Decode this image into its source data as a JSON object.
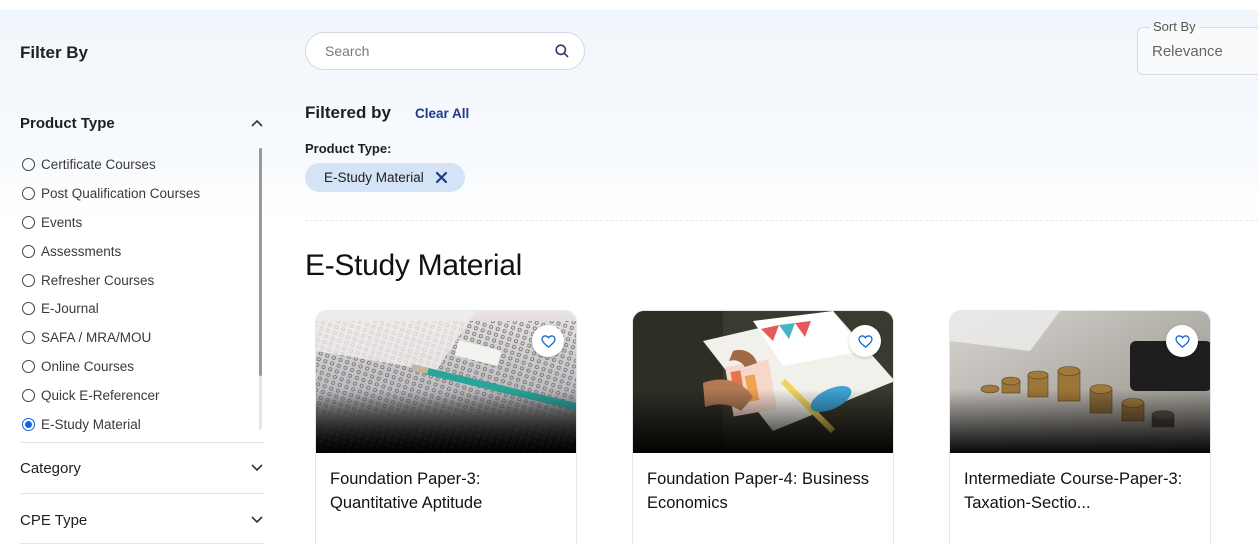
{
  "sidebar": {
    "title": "Filter By",
    "product_type": {
      "label": "Product Type",
      "expanded": true,
      "options": [
        {
          "label": "Certificate Courses",
          "checked": false
        },
        {
          "label": "Post Qualification Courses",
          "checked": false
        },
        {
          "label": "Events",
          "checked": false
        },
        {
          "label": "Assessments",
          "checked": false
        },
        {
          "label": "Refresher Courses",
          "checked": false
        },
        {
          "label": "E-Journal",
          "checked": false
        },
        {
          "label": "SAFA / MRA/MOU",
          "checked": false
        },
        {
          "label": "Online Courses",
          "checked": false
        },
        {
          "label": "Quick E-Referencer",
          "checked": false
        },
        {
          "label": "E-Study Material",
          "checked": true
        }
      ]
    },
    "category": {
      "label": "Category",
      "expanded": false
    },
    "cpe_type": {
      "label": "CPE Type",
      "expanded": false
    }
  },
  "search": {
    "placeholder": "Search",
    "value": "",
    "icon": "search-icon"
  },
  "sort": {
    "legend": "Sort By",
    "value": "Relevance"
  },
  "filters": {
    "heading": "Filtered by",
    "clear_all": "Clear All",
    "product_type_label": "Product Type:",
    "chips": [
      {
        "label": "E-Study Material",
        "icon": "close-icon"
      }
    ]
  },
  "main": {
    "title": "E-Study Material",
    "cards": [
      {
        "title": "Foundation Paper-3: Quantitative Aptitude",
        "image": "exam-sheet-pencil-photo"
      },
      {
        "title": "Foundation Paper-4: Business Economics",
        "image": "charts-desk-photo"
      },
      {
        "title": "Intermediate Course-Paper-3: Taxation-Sectio...",
        "image": "coin-stacks-photo"
      }
    ]
  },
  "colors": {
    "accent": "#1565d8",
    "chip_bg": "#d4e3f6",
    "link": "#1f3a8a",
    "band_bg": "#f1f6fc"
  }
}
